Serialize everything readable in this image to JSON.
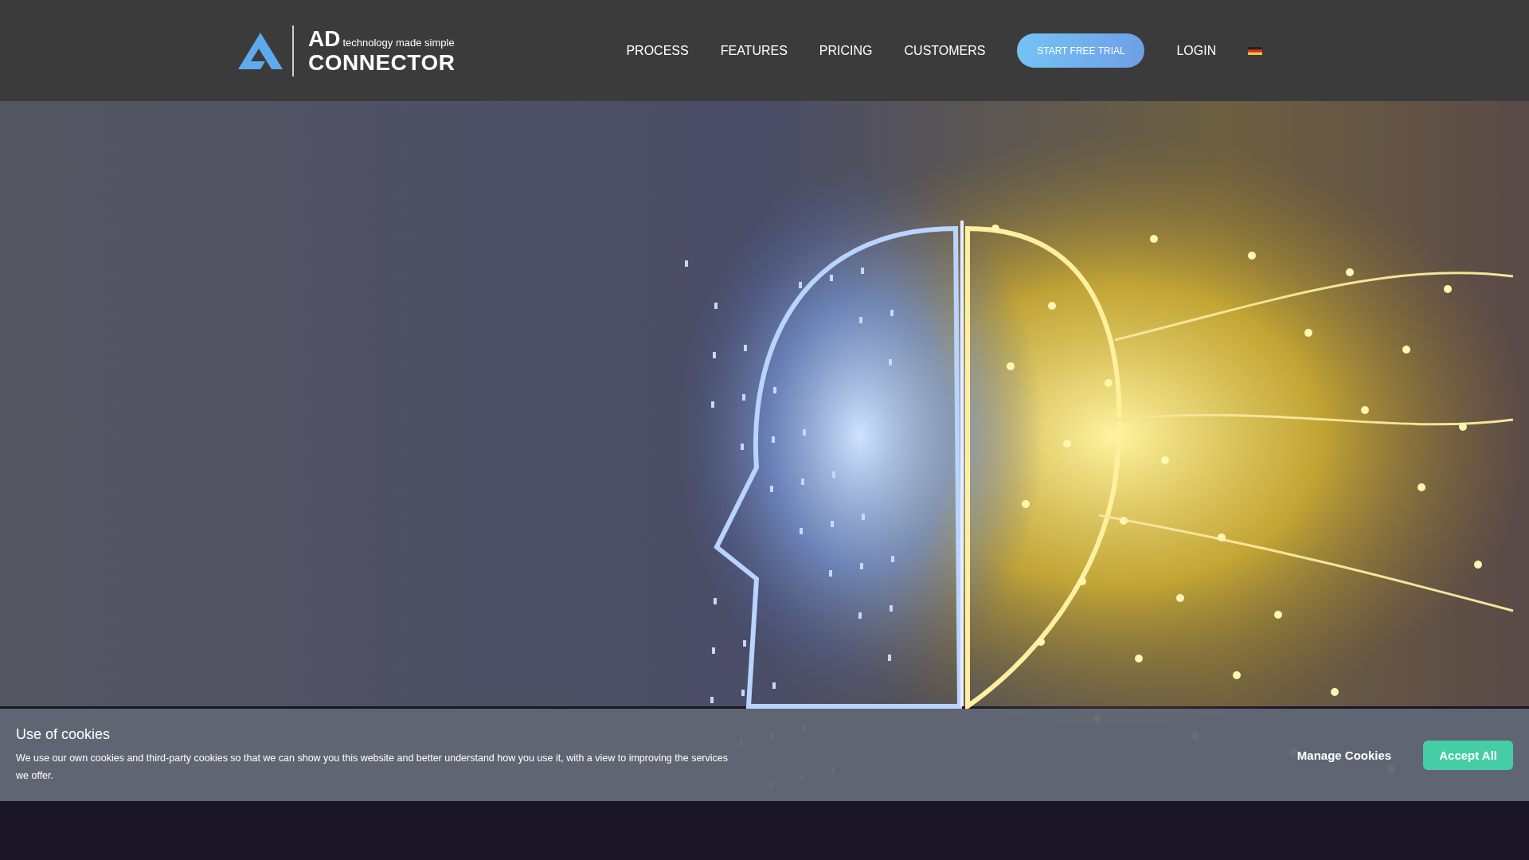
{
  "header": {
    "logo": {
      "abbr": "AD",
      "tagline": "technology made simple",
      "name": "CONNECTOR"
    },
    "nav": [
      {
        "label": "PROCESS"
      },
      {
        "label": "FEATURES"
      },
      {
        "label": "PRICING"
      },
      {
        "label": "CUSTOMERS"
      }
    ],
    "cta": "START FREE TRIAL",
    "login": "LOGIN"
  },
  "cookie_banner": {
    "title": "Use of cookies",
    "text": "We use our own cookies and third-party cookies so that we can show you this website and better understand how you use it, with a view to improving the services we offer.",
    "buttons": [
      {
        "label": "Manage Cookies",
        "kind": "link"
      },
      {
        "label": "Accept All",
        "kind": "primary"
      }
    ]
  }
}
